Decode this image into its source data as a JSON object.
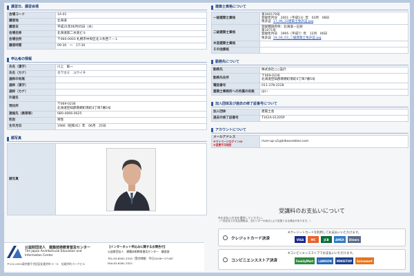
{
  "left": {
    "sec1_title": "講習日、講習会場",
    "sec1_rows": [
      {
        "label": "会場コード",
        "value": "1A-01"
      },
      {
        "label": "講習地",
        "value": "北海道"
      },
      {
        "label": "講習日",
        "value": "平成31年06月05日（水）"
      },
      {
        "label": "会場名称",
        "value": "北海道第二水道ビル"
      },
      {
        "label": "会場住所",
        "value": "〒060-0003 札幌市中央区北３条西７－１"
      },
      {
        "label": "講習時間",
        "value": "09:30　～　17:30"
      }
    ],
    "sec2_title": "申込者の情報",
    "sec2_rows": [
      {
        "label": "氏名（漢字）",
        "value": "川上　毅一"
      },
      {
        "label": "氏名（カナ）",
        "value": "カワカミ　ユウイチ"
      },
      {
        "label": "通称の有無",
        "value": ""
      },
      {
        "label": "通称（漢字）",
        "value": ""
      },
      {
        "label": "通称（カナ）",
        "value": ""
      },
      {
        "label": "外国名",
        "value": ""
      },
      {
        "label": "現住所",
        "value": "〒069-0236\n北海道空知郡南幌町南町4丁目7番5号"
      },
      {
        "label": "連絡先（携帯等）",
        "value": "080-4066-0625"
      },
      {
        "label": "性別",
        "value": "男性"
      },
      {
        "label": "生年月日",
        "value": "1966（昭和41）年　06月　25日"
      }
    ],
    "sec3_title": "顔写真",
    "photo_label": "顔写真"
  },
  "right": {
    "sec1_title": "建築士資格について",
    "license_rows": [
      {
        "label": "一級建築士資格",
        "lines": [
          "第300179号",
          "登録年月日　2001（平成13）年　03月　08日",
          "免許証"
        ],
        "link": "17_06_22建築士免許証.jpg"
      },
      {
        "label": "二級建築士資格",
        "lines": [
          "登録都道府県：北海道－石狩",
          "第1071号",
          "登録年月日　1995（平成7）年　12月　06日",
          "免許証"
        ],
        "link": "19_04_03_二級建築士免許証.jpg"
      },
      {
        "label": "木造建築士資格",
        "lines": [],
        "link": ""
      },
      {
        "label": "その他資格",
        "lines": [],
        "link": ""
      }
    ],
    "sec2_title": "勤務先について",
    "work_rows": [
      {
        "label": "勤務先",
        "value": "株式会社○○設計"
      },
      {
        "label": "勤務先住所",
        "value": "〒069-0236\n北海道空知郡南幌町南町4丁目7番5号"
      },
      {
        "label": "電話番号",
        "value": "011-378-2228"
      },
      {
        "label": "建築士事務所への所属の有無",
        "value": "はい"
      }
    ],
    "sec3_title": "加入団体及び過去の修了証番号について",
    "group_rows": [
      {
        "label": "加入団体",
        "value": "建築士会"
      },
      {
        "label": "過去の修了証番号",
        "value": "T161A-S1205P"
      }
    ],
    "sec4_title": "アカウントについて",
    "mail_label": "メールアドレス",
    "mail_note1": "※マイページログインID",
    "mail_note2": "※変更不可項目",
    "mail_value": "river-up-u1@kibousekkei.com"
  },
  "payment": {
    "title": "受講料のお支払いについて",
    "note1": "※お支払い方法を選択してください。",
    "note2": "（一括支払での支払期限は、当センターの休日により変更となる場合があります。）",
    "card_label": "クレジットカード決済",
    "card_note": "※クレジットカードを利用してお支払いいただけます。",
    "conv_label": "コンビニエンスストア決済",
    "conv_note": "※コンビニエンスストアでお支払いいただけます。",
    "card_logos": [
      "VISA",
      "MC",
      "JCB",
      "AMEX",
      "Diners"
    ],
    "conv_logos": [
      "FamilyMart",
      "LAWSON",
      "MINISTOP",
      "Seicomart"
    ]
  },
  "footer": {
    "org_line1": "公益財団法人　建築技術教育普及センター",
    "org_line2": "The Japan Architectural Education and",
    "org_line3": "Information Center",
    "address": "〒102-0094東京都千代田区紀尾井町３－６　紀尾井町パークビル",
    "contact_title": "【インターネット申込みに関するお問合せ】",
    "contact_body": "公益財団法人　建築技術教育普及センター　講習部",
    "tel": "TEL:03-6261-3310（受付時間：平日10:00～17:00）",
    "fax": "FAX:03-6261-3321"
  },
  "colors": {
    "accent": "#1d3f7a",
    "label_bg": "#dde5ef",
    "page_bg": "#b8c9df"
  }
}
